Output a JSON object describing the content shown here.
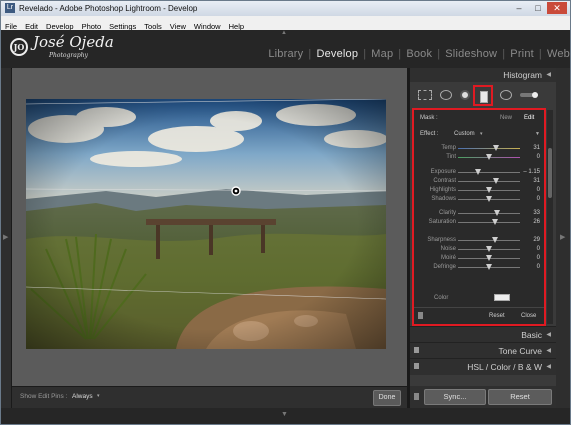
{
  "window": {
    "title": "Revelado - Adobe Photoshop Lightroom - Develop",
    "app_icon": "Lr"
  },
  "menu": [
    "File",
    "Edit",
    "Develop",
    "Photo",
    "Settings",
    "Tools",
    "View",
    "Window",
    "Help"
  ],
  "identity": {
    "name": "José Ojeda",
    "sub": "Photography"
  },
  "modules": [
    {
      "label": "Library",
      "active": false
    },
    {
      "label": "Develop",
      "active": true
    },
    {
      "label": "Map",
      "active": false
    },
    {
      "label": "Book",
      "active": false
    },
    {
      "label": "Slideshow",
      "active": false
    },
    {
      "label": "Print",
      "active": false
    },
    {
      "label": "Web",
      "active": false
    }
  ],
  "toolbar": {
    "edit_pins_label": "Show Edit Pins :",
    "edit_pins_value": "Always",
    "done_label": "Done"
  },
  "panel": {
    "histogram_title": "Histogram",
    "brush": {
      "mask_label": "Mask :",
      "new_label": "New",
      "edit_label": "Edit",
      "effect_label": "Effect :",
      "effect_value": "Custom",
      "color_label": "Color",
      "reset_label": "Reset",
      "close_label": "Close",
      "sliders": [
        {
          "label": "Temp",
          "value": "31",
          "pos": 0.62
        },
        {
          "label": "Tint",
          "value": "0",
          "pos": 0.5
        },
        {
          "label": "Exposure",
          "value": "– 1.15",
          "pos": 0.32
        },
        {
          "label": "Contrast",
          "value": "31",
          "pos": 0.62
        },
        {
          "label": "Highlights",
          "value": "0",
          "pos": 0.5
        },
        {
          "label": "Shadows",
          "value": "0",
          "pos": 0.5
        },
        {
          "label": "Clarity",
          "value": "33",
          "pos": 0.63
        },
        {
          "label": "Saturation",
          "value": "26",
          "pos": 0.6
        },
        {
          "label": "Sharpness",
          "value": "29",
          "pos": 0.6
        },
        {
          "label": "Noise",
          "value": "0",
          "pos": 0.5
        },
        {
          "label": "Moiré",
          "value": "0",
          "pos": 0.5
        },
        {
          "label": "Defringe",
          "value": "0",
          "pos": 0.5
        }
      ]
    },
    "sections": [
      "Basic",
      "Tone Curve",
      "HSL / Color / B & W"
    ],
    "sync_label": "Sync...",
    "reset_label": "Reset"
  },
  "colors": {
    "highlight": "#e01a22",
    "panel": "#3a3a3a"
  }
}
